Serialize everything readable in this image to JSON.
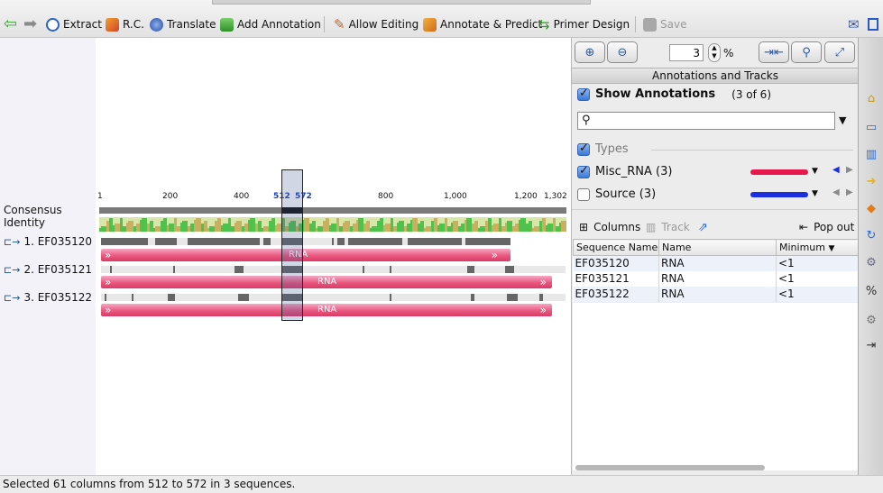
{
  "toolbar": {
    "extract": "Extract",
    "rc": "R.C.",
    "translate": "Translate",
    "add_annotation": "Add Annotation",
    "allow_editing": "Allow Editing",
    "annotate_predict": "Annotate & Predict",
    "primer_design": "Primer Design",
    "save": "Save"
  },
  "viewer": {
    "consensus_label": "Consensus",
    "identity_label": "Identity",
    "ruler_ticks": [
      "1",
      "200",
      "400",
      "512",
      "572",
      "800",
      "1,000",
      "1,200",
      "1,302"
    ],
    "sequences": [
      {
        "name": "1. EF035120",
        "annotation": "RNA"
      },
      {
        "name": "2. EF035121",
        "annotation": "RNA"
      },
      {
        "name": "3. EF035122",
        "annotation": "RNA"
      }
    ],
    "selection": {
      "start": 512,
      "end": 572
    }
  },
  "right_panel": {
    "zoom_value": "3",
    "zoom_unit": "%",
    "section_title": "Annotations and Tracks",
    "show_annotations_label": "Show Annotations",
    "show_annotations_count": "(3 of 6)",
    "search_placeholder": "",
    "types_label": "Types",
    "types": [
      {
        "label": "Misc_RNA (3)",
        "checked": true,
        "color": "#e8184f"
      },
      {
        "label": "Source (3)",
        "checked": false,
        "color": "#1b2fe0"
      }
    ],
    "columns_label": "Columns",
    "track_label": "Track",
    "popout_label": "Pop out",
    "table": {
      "headers": [
        "Sequence Name",
        "Name",
        "Minimum"
      ],
      "rows": [
        [
          "EF035120",
          "RNA",
          "<1"
        ],
        [
          "EF035121",
          "RNA",
          "<1"
        ],
        [
          "EF035122",
          "RNA",
          "<1"
        ]
      ]
    }
  },
  "status": "Selected 61 columns from 512 to 572 in 3 sequences.",
  "colors": {
    "accent": "#3a78d6",
    "annotation": "#e9587f",
    "identity_green": "#4ec24a",
    "selection": "#1b3fc4"
  }
}
